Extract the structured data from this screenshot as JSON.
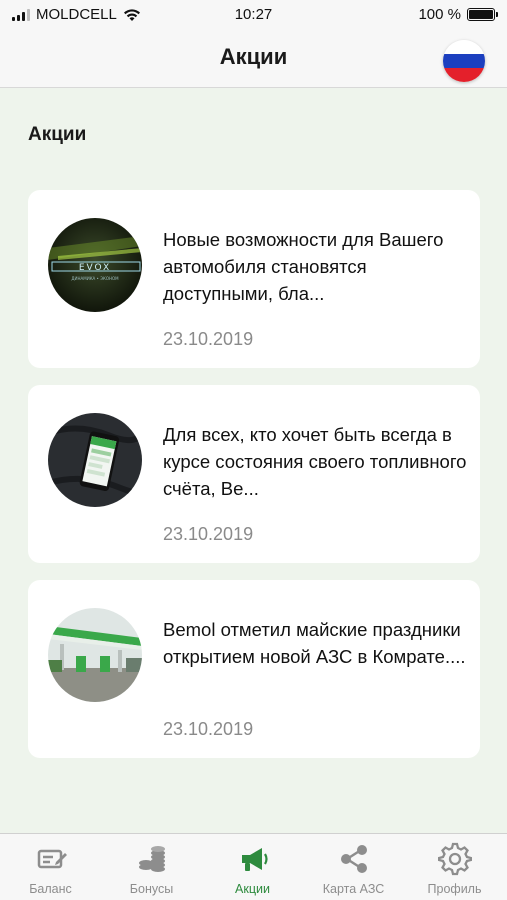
{
  "status_bar": {
    "carrier": "MOLDCELL",
    "time": "10:27",
    "battery": "100 %"
  },
  "header": {
    "title": "Акции",
    "language_flag": "russian-flag-icon"
  },
  "section": {
    "title": "Акции"
  },
  "promotions": [
    {
      "thumb": "evox-promo-image",
      "text": "Новые возможности для Вашего автомобиля становятся доступными, бла...",
      "date": "23.10.2019"
    },
    {
      "thumb": "phone-app-promo-image",
      "text": "Для всех, кто хочет быть всегда в курсе состояния своего топливного счёта, Ве...",
      "date": "23.10.2019"
    },
    {
      "thumb": "gas-station-promo-image",
      "text": "Bemol отметил майские праздники открытием новой АЗС в Комрате....",
      "date": "23.10.2019"
    }
  ],
  "tabs": [
    {
      "label": "Баланс",
      "icon": "balance-icon",
      "active": false
    },
    {
      "label": "Бонусы",
      "icon": "coins-icon",
      "active": false
    },
    {
      "label": "Акции",
      "icon": "megaphone-icon",
      "active": true
    },
    {
      "label": "Карта АЗС",
      "icon": "share-map-icon",
      "active": false
    },
    {
      "label": "Профиль",
      "icon": "gear-icon",
      "active": false
    }
  ],
  "colors": {
    "accent": "#2e8b3e",
    "background": "#eef4ec",
    "inactive": "#8d8d8d"
  }
}
